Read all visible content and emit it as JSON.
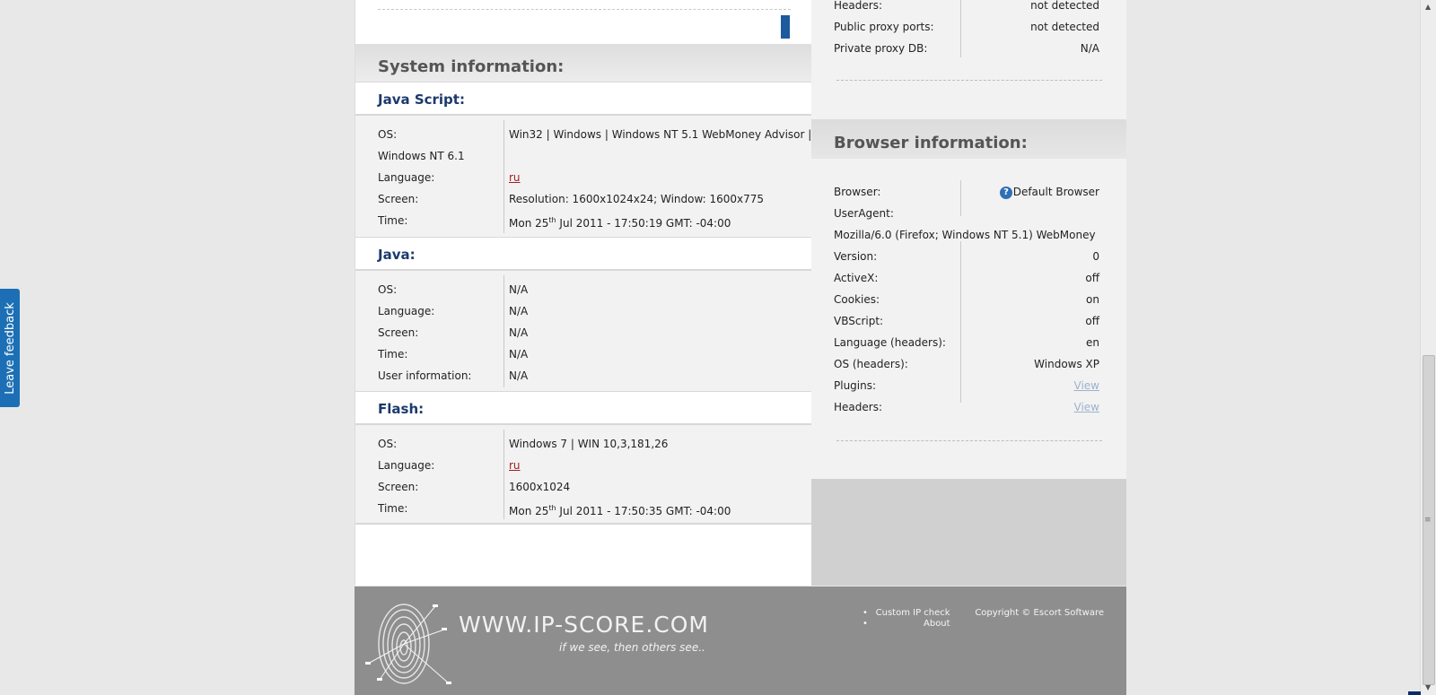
{
  "feedback": {
    "label": "Leave feedback"
  },
  "system_info": {
    "title": "System information:",
    "javascript": {
      "title": "Java Script:",
      "rows": [
        {
          "label": "OS:",
          "value": "Win32 | Windows | Windows NT 5.1 WebMoney Advisor |",
          "value2": "Windows NT 6.1"
        },
        {
          "label": "Language:",
          "value": "ru"
        },
        {
          "label": "Screen:",
          "value": "Resolution: 1600x1024x24; Window: 1600x775"
        },
        {
          "label": "Time:",
          "value_pre": "Mon 25",
          "value_sup": "th",
          "value_post": " Jul 2011 - 17:50:19 GMT: -04:00"
        }
      ]
    },
    "java": {
      "title": "Java:",
      "rows": [
        {
          "label": "OS:",
          "value": "N/A"
        },
        {
          "label": "Language:",
          "value": "N/A"
        },
        {
          "label": "Screen:",
          "value": "N/A"
        },
        {
          "label": "Time:",
          "value": "N/A"
        },
        {
          "label": "User information:",
          "value": "N/A"
        }
      ]
    },
    "flash": {
      "title": "Flash:",
      "rows": [
        {
          "label": "OS:",
          "value": "Windows 7 | WIN 10,3,181,26"
        },
        {
          "label": "Language:",
          "value": "ru"
        },
        {
          "label": "Screen:",
          "value": "1600x1024"
        },
        {
          "label": "Time:",
          "value_pre": "Mon 25",
          "value_sup": "th",
          "value_post": " Jul 2011 - 17:50:35 GMT: -04:00"
        }
      ]
    }
  },
  "proxy_info": {
    "rows": [
      {
        "label": "Headers:",
        "value": "not detected"
      },
      {
        "label": "Public proxy ports:",
        "value": "not detected"
      },
      {
        "label": "Private proxy DB:",
        "value": "N/A"
      }
    ]
  },
  "browser_info": {
    "title": "Browser information:",
    "browser": {
      "label": "Browser:",
      "value": "Default Browser",
      "icon": "help-icon"
    },
    "useragent": {
      "label": "UserAgent:",
      "value": "Mozilla/6.0 (Firefox; Windows NT 5.1) WebMoney"
    },
    "rows": [
      {
        "label": "Version:",
        "value": "0"
      },
      {
        "label": "ActiveX:",
        "value": "off"
      },
      {
        "label": "Cookies:",
        "value": "on"
      },
      {
        "label": "VBScript:",
        "value": "off"
      },
      {
        "label": "Language (headers):",
        "value": "en"
      },
      {
        "label": "OS (headers):",
        "value": "Windows XP"
      },
      {
        "label": "Plugins:",
        "value": "View"
      },
      {
        "label": "Headers:",
        "value": "View"
      }
    ]
  },
  "footer": {
    "logo": "WWW.IP-SCORE.COM",
    "tagline": "if we see, then others see..",
    "nav": [
      "Custom IP check",
      "About"
    ],
    "copyright": "Copyright © Escort Software"
  }
}
